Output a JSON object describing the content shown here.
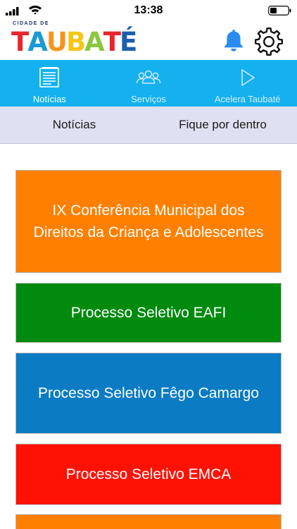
{
  "status_bar": {
    "time": "13:38"
  },
  "header": {
    "logo_top_text": "CIDADE DE",
    "logo_letters": [
      {
        "char": "T",
        "color": "#e8262c"
      },
      {
        "char": "A",
        "color": "#1a9ad6"
      },
      {
        "char": "U",
        "color": "#f7941d"
      },
      {
        "char": "B",
        "color": "#f5c518"
      },
      {
        "char": "A",
        "color": "#8dc63f"
      },
      {
        "char": "T",
        "color": "#e8262c"
      },
      {
        "char": "É",
        "color": "#1b5fae"
      }
    ],
    "bell_icon": "bell-icon",
    "settings_icon": "gear-icon"
  },
  "tabs": [
    {
      "label": "Notícias",
      "icon": "newspaper-icon",
      "active": true
    },
    {
      "label": "Serviços",
      "icon": "people-icon",
      "active": false
    },
    {
      "label": "Acelera Taubaté",
      "icon": "play-icon",
      "active": false
    }
  ],
  "subtabs": [
    {
      "label": "Notícias"
    },
    {
      "label": "Fique por dentro"
    }
  ],
  "cards": [
    {
      "title": "IX Conferência Municipal dos Direitos da Criança e Adolescentes",
      "color": "#ff7f00"
    },
    {
      "title": "Processo Seletivo EAFI",
      "color": "#008a0e"
    },
    {
      "title": "Processo Seletivo Fêgo Camargo",
      "color": "#0b7bc4"
    },
    {
      "title": "Processo Seletivo EMCA",
      "color": "#ff1205"
    },
    {
      "title": "",
      "color": "#ff7f00"
    }
  ],
  "colors": {
    "tabbar": "#14b1ee",
    "subtabs": "#dfe0f1",
    "bell": "#2b8cf0"
  }
}
